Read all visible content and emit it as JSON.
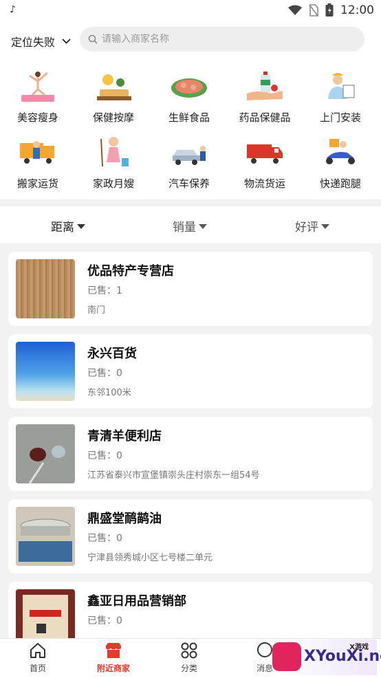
{
  "status_bar": {
    "time": "12:00"
  },
  "header": {
    "location": "定位失败",
    "search_placeholder": "请输入商家名称"
  },
  "categories": [
    {
      "label": "美容瘦身",
      "icon": "yoga-icon"
    },
    {
      "label": "保健按摩",
      "icon": "massage-icon"
    },
    {
      "label": "生鲜食品",
      "icon": "fresh-food-icon"
    },
    {
      "label": "药品保健品",
      "icon": "medicine-icon"
    },
    {
      "label": "上门安装",
      "icon": "installer-icon"
    },
    {
      "label": "搬家运货",
      "icon": "moving-icon"
    },
    {
      "label": "家政月嫂",
      "icon": "housekeeping-icon"
    },
    {
      "label": "汽车保养",
      "icon": "car-care-icon"
    },
    {
      "label": "物流货运",
      "icon": "truck-icon"
    },
    {
      "label": "快递跑腿",
      "icon": "courier-scooter-icon"
    }
  ],
  "sort_tabs": [
    {
      "label": "距离"
    },
    {
      "label": "销量"
    },
    {
      "label": "好评"
    }
  ],
  "stores": [
    {
      "name": "优品特产专营店",
      "sold": "已售：1",
      "address": "南门"
    },
    {
      "name": "永兴百货",
      "sold": "已售：0",
      "address": "东邻100米"
    },
    {
      "name": "青清羊便利店",
      "sold": "已售：0",
      "address": "江苏省泰兴市宣堡镇崇头庄村崇东一组54号"
    },
    {
      "name": "鼎盛堂鸸鹋油",
      "sold": "已售：0",
      "address": "宁津县领秀城小区七号楼二单元"
    },
    {
      "name": "鑫亚日用品营销部",
      "sold": "已售：0",
      "address": ""
    }
  ],
  "bottom_nav": [
    {
      "label": "首页"
    },
    {
      "label": "附近商家"
    },
    {
      "label": "分类"
    },
    {
      "label": "消息"
    }
  ],
  "watermark": {
    "text": "XYouXi.net",
    "small": "X游戏"
  },
  "colors": {
    "accent": "#e23b2a",
    "background": "#f2f2f2"
  }
}
